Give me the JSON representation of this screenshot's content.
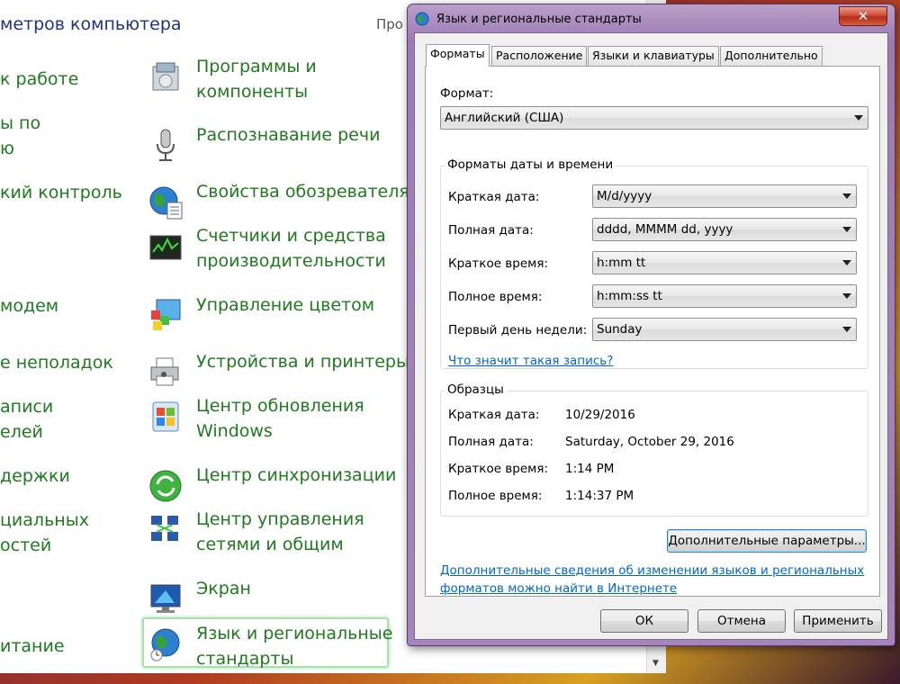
{
  "control_panel": {
    "header": "метров компьютера",
    "header_right": "Про",
    "left_links": [
      "к работе",
      "ы по",
      "ю",
      "кий контроль",
      "модем",
      "е неполадок",
      "аписи",
      "елей",
      "держки",
      "циальных",
      "остей",
      "итание"
    ],
    "items": [
      {
        "line1": "Программы и",
        "line2": "компоненты",
        "icon": "programs-icon"
      },
      {
        "line1": "Распознавание речи",
        "line2": "",
        "icon": "microphone-icon"
      },
      {
        "line1": "Свойства обозревателя",
        "line2": "",
        "icon": "globe-icon"
      },
      {
        "line1": "Счетчики и средства",
        "line2": "производительности",
        "icon": "performance-icon"
      },
      {
        "line1": "Управление цветом",
        "line2": "",
        "icon": "color-management-icon"
      },
      {
        "line1": "Устройства и принтеры",
        "line2": "",
        "icon": "printer-icon"
      },
      {
        "line1": "Центр обновления",
        "line2": "Windows",
        "icon": "windows-update-icon"
      },
      {
        "line1": "Центр синхронизации",
        "line2": "",
        "icon": "sync-icon"
      },
      {
        "line1": "Центр управления",
        "line2": "сетями и общим",
        "icon": "network-icon"
      },
      {
        "line1": "Экран",
        "line2": "",
        "icon": "display-icon"
      },
      {
        "line1": "Язык и региональные",
        "line2": "стандарты",
        "icon": "region-globe-icon"
      }
    ]
  },
  "dialog": {
    "title": "Язык и региональные стандарты",
    "close_label": "✕",
    "tabs": [
      "Форматы",
      "Расположение",
      "Языки и клавиатуры",
      "Дополнительно"
    ],
    "active_tab": "Форматы",
    "format_label": "Формат:",
    "format_value": "Английский (США)",
    "datetime_group": "Форматы даты и времени",
    "rows": [
      {
        "label": "Краткая дата:",
        "value": "M/d/yyyy"
      },
      {
        "label": "Полная дата:",
        "value": "dddd, MMMM dd, yyyy"
      },
      {
        "label": "Краткое время:",
        "value": "h:mm tt"
      },
      {
        "label": "Полное время:",
        "value": "h:mm:ss tt"
      },
      {
        "label": "Первый день недели:",
        "value": "Sunday"
      }
    ],
    "notation_link": "Что значит такая запись?",
    "samples_group": "Образцы",
    "samples": [
      {
        "label": "Краткая дата:",
        "value": "10/29/2016"
      },
      {
        "label": "Полная дата:",
        "value": "Saturday, October 29, 2016"
      },
      {
        "label": "Краткое время:",
        "value": "1:14 PM"
      },
      {
        "label": "Полное время:",
        "value": "1:14:37 PM"
      }
    ],
    "advanced_button": "Дополнительные параметры...",
    "info_link_line1": "Дополнительные сведения об изменении языков и региональных",
    "info_link_line2": "форматов можно найти в Интернете",
    "ok": "ОК",
    "cancel": "Отмена",
    "apply": "Применить"
  }
}
